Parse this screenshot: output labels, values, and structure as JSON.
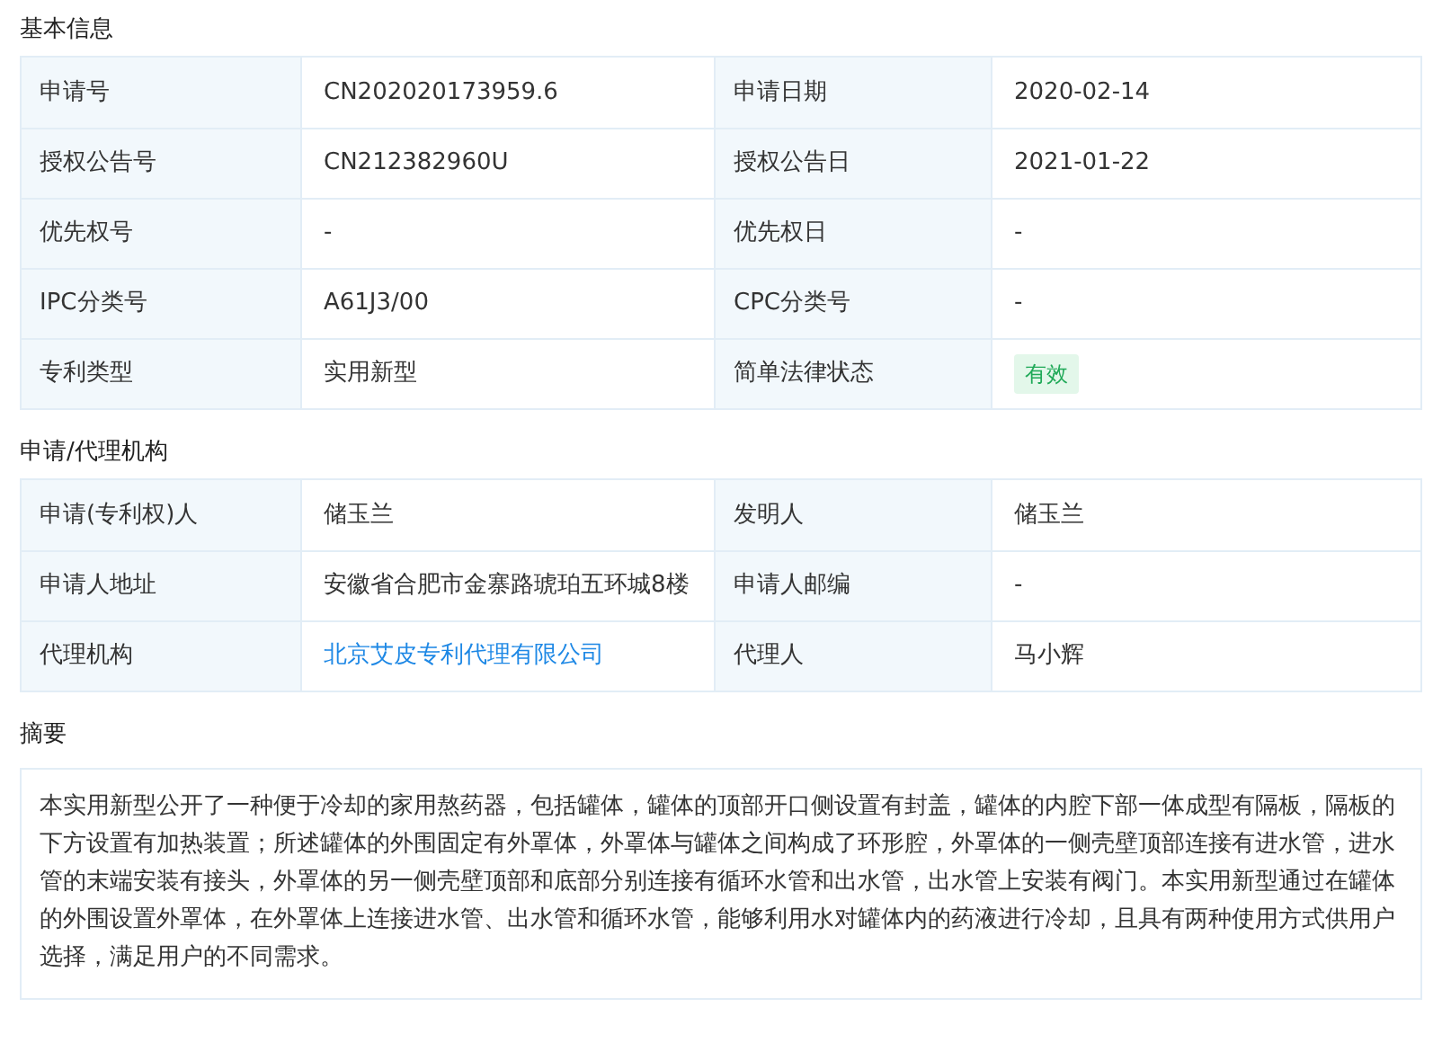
{
  "sections": [
    {
      "title": "基本信息",
      "kind": "table",
      "rows": [
        [
          {
            "label": "申请号",
            "value": "CN202020173959.6",
            "kind": "text"
          },
          {
            "label": "申请日期",
            "value": "2020-02-14",
            "kind": "text"
          }
        ],
        [
          {
            "label": "授权公告号",
            "value": "CN212382960U",
            "kind": "text"
          },
          {
            "label": "授权公告日",
            "value": "2021-01-22",
            "kind": "text"
          }
        ],
        [
          {
            "label": "优先权号",
            "value": "-",
            "kind": "text"
          },
          {
            "label": "优先权日",
            "value": "-",
            "kind": "text"
          }
        ],
        [
          {
            "label": "IPC分类号",
            "value": "A61J3/00",
            "kind": "text"
          },
          {
            "label": "CPC分类号",
            "value": "-",
            "kind": "text"
          }
        ],
        [
          {
            "label": "专利类型",
            "value": "实用新型",
            "kind": "text"
          },
          {
            "label": "简单法律状态",
            "value": "有效",
            "kind": "tag"
          }
        ]
      ]
    },
    {
      "title": "申请/代理机构",
      "kind": "table",
      "rows": [
        [
          {
            "label": "申请(专利权)人",
            "value": "储玉兰",
            "kind": "text"
          },
          {
            "label": "发明人",
            "value": "储玉兰",
            "kind": "text"
          }
        ],
        [
          {
            "label": "申请人地址",
            "value": "安徽省合肥市金寨路琥珀五环城8楼",
            "kind": "text"
          },
          {
            "label": "申请人邮编",
            "value": "-",
            "kind": "text"
          }
        ],
        [
          {
            "label": "代理机构",
            "value": "北京艾皮专利代理有限公司",
            "kind": "link"
          },
          {
            "label": "代理人",
            "value": "马小辉",
            "kind": "text"
          }
        ]
      ]
    },
    {
      "title": "摘要",
      "kind": "text",
      "text": "本实用新型公开了一种便于冷却的家用熬药器，包括罐体，罐体的顶部开口侧设置有封盖，罐体的内腔下部一体成型有隔板，隔板的下方设置有加热装置；所述罐体的外围固定有外罩体，外罩体与罐体之间构成了环形腔，外罩体的一侧壳壁顶部连接有进水管，进水管的末端安装有接头，外罩体的另一侧壳壁顶部和底部分别连接有循环水管和出水管，出水管上安装有阀门。本实用新型通过在罐体的外围设置外罩体，在外罩体上连接进水管、出水管和循环水管，能够利用水对罐体内的药液进行冷却，且具有两种使用方式供用户选择，满足用户的不同需求。"
    }
  ]
}
